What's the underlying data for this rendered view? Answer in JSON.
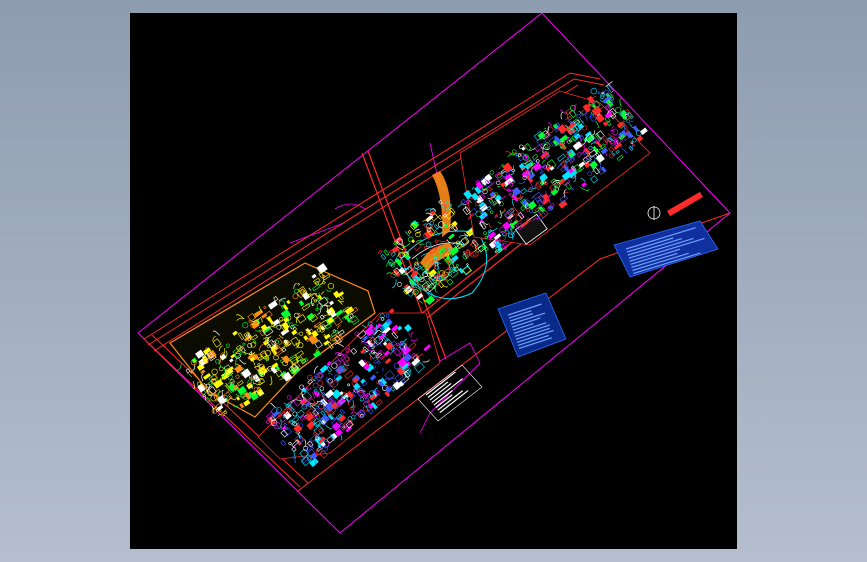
{
  "window": {
    "title": ""
  },
  "drawing": {
    "background": "#000000",
    "colors": {
      "boundary": "#ff00ff",
      "road": "#ff2a2a",
      "building_cyan": "#00e5ff",
      "building_blue": "#3a5cff",
      "building_white": "#ffffff",
      "landscape_yellow": "#ffff00",
      "landscape_green": "#00ff33",
      "accent_orange": "#ff8c1a",
      "legend_blue": "#2a6cff"
    },
    "legend_items": [
      {
        "icon": "north-arrow-icon"
      },
      {
        "icon": "legend-table-icon"
      },
      {
        "icon": "index-table-icon"
      },
      {
        "icon": "notes-table-icon"
      }
    ]
  }
}
